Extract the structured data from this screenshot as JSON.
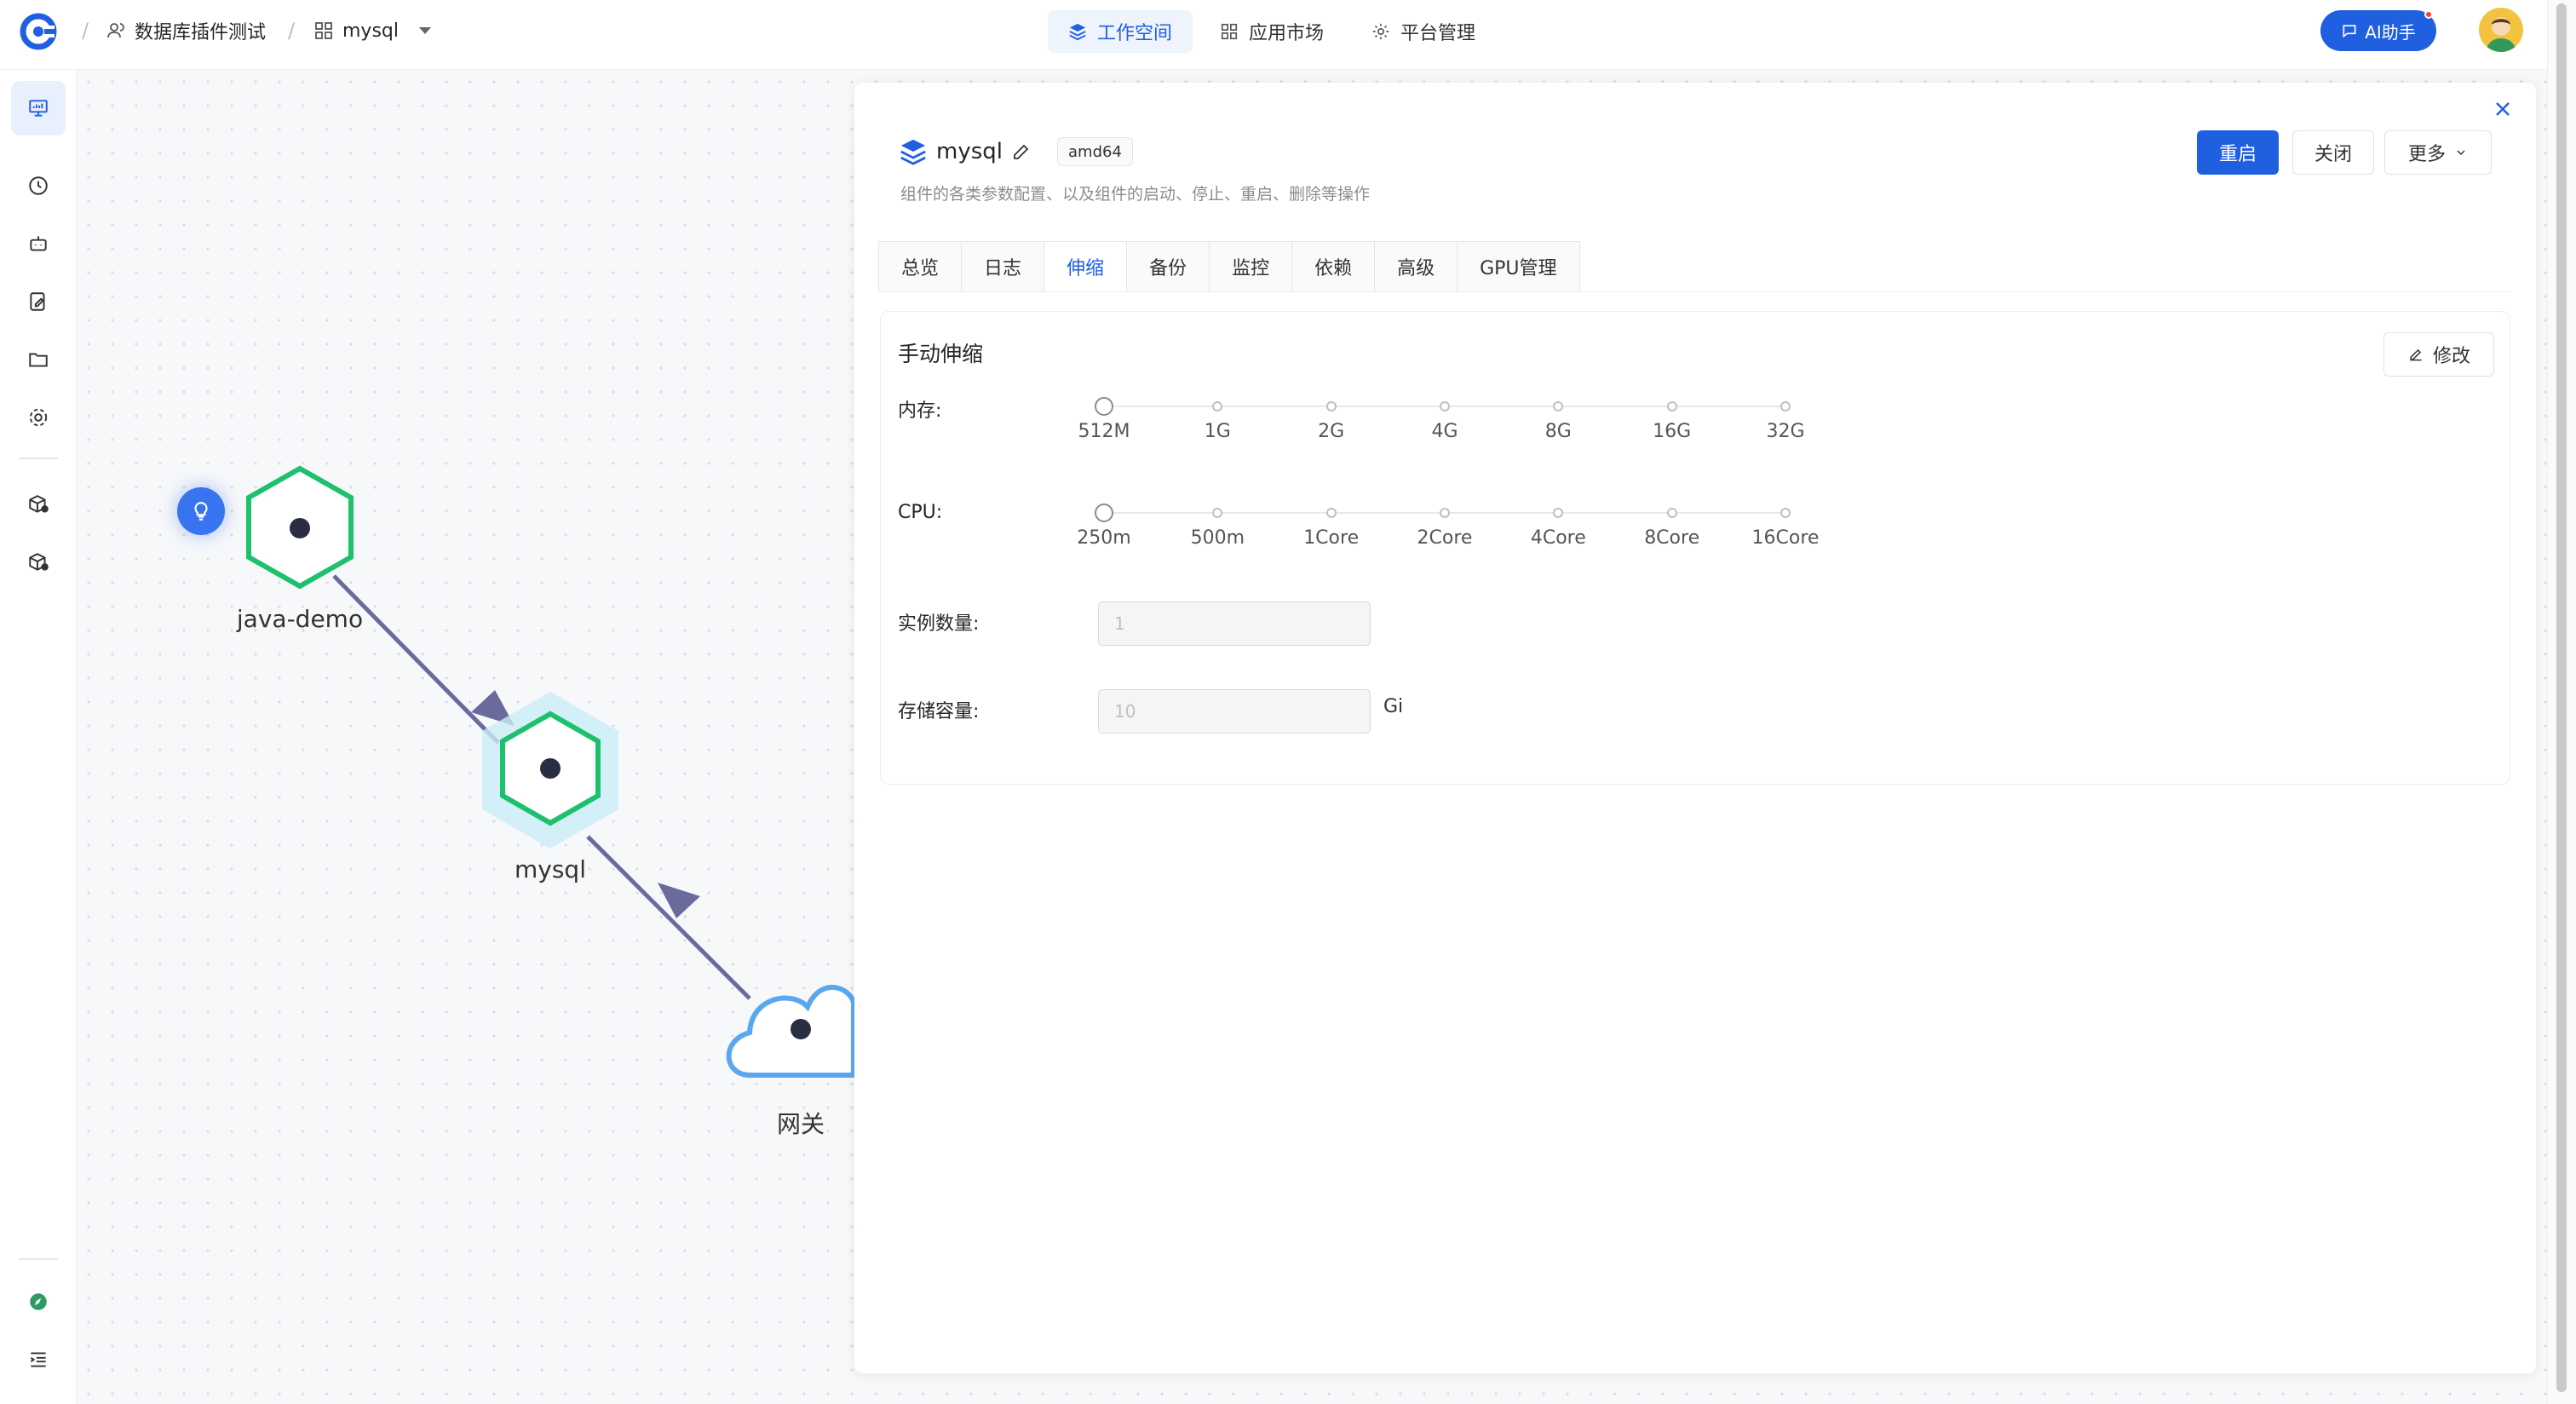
{
  "breadcrumb": {
    "team": "数据库插件测试",
    "app": "mysql"
  },
  "nav": {
    "workspace": "工作空间",
    "market": "应用市场",
    "platform": "平台管理"
  },
  "ai_button": "AI助手",
  "topology": {
    "nodes": [
      {
        "label": "java-demo"
      },
      {
        "label": "mysql"
      },
      {
        "label": "网关"
      }
    ]
  },
  "panel": {
    "title": "mysql",
    "arch": "amd64",
    "description": "组件的各类参数配置、以及组件的启动、停止、重启、删除等操作",
    "buttons": {
      "restart": "重启",
      "close": "关闭",
      "more": "更多"
    },
    "tabs": [
      "总览",
      "日志",
      "伸缩",
      "备份",
      "监控",
      "依赖",
      "高级",
      "GPU管理"
    ],
    "active_tab": "伸缩",
    "scale": {
      "title": "手动伸缩",
      "edit": "修改",
      "memory_label": "内存:",
      "memory_marks": [
        "512M",
        "1G",
        "2G",
        "4G",
        "8G",
        "16G",
        "32G"
      ],
      "memory_value": "512M",
      "cpu_label": "CPU:",
      "cpu_marks": [
        "250m",
        "500m",
        "1Core",
        "2Core",
        "4Core",
        "8Core",
        "16Core"
      ],
      "cpu_value": "250m",
      "instance_label": "实例数量:",
      "instance_value": "1",
      "storage_label": "存储容量:",
      "storage_value": "10",
      "storage_unit": "Gi"
    }
  },
  "colors": {
    "primary": "#1f5fe0",
    "node_green": "#1ec16b",
    "edge": "#6b6a9c",
    "gateway_blue": "#5aa7f0"
  }
}
